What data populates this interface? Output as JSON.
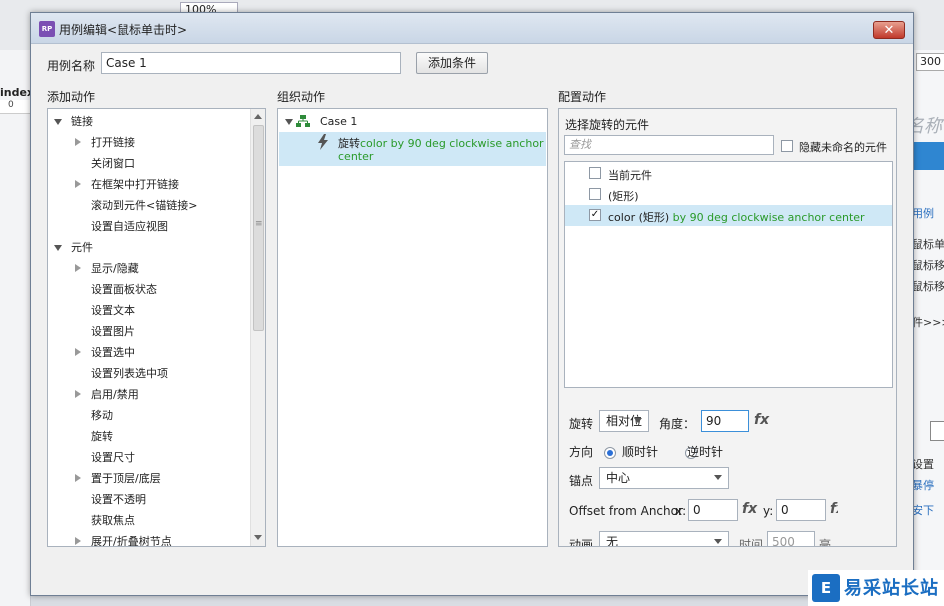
{
  "background": {
    "zoom_value": "100%",
    "index_label": "index",
    "ruler_zero": "0",
    "right_input_value": "300",
    "right_title": "名称",
    "right_link_case": "用例",
    "right_events": [
      "鼠标单击",
      "鼠标移入",
      "鼠标移出"
    ],
    "right_more": "件>>>",
    "right_settings": "设置",
    "right_link_stop": "暴停",
    "right_link_down": "安下"
  },
  "dialog": {
    "app_icon": "RP",
    "title": "用例编辑<鼠标单击时>",
    "close_symbol": "✕",
    "case_name_label": "用例名称",
    "case_name_value": "Case 1",
    "add_condition_label": "添加条件"
  },
  "add_actions": {
    "header": "添加动作",
    "items": [
      {
        "label": "链接",
        "level": 0,
        "arrow": "down"
      },
      {
        "label": "打开链接",
        "level": 1,
        "arrow": "right"
      },
      {
        "label": "关闭窗口",
        "level": 1,
        "arrow": "none"
      },
      {
        "label": "在框架中打开链接",
        "level": 1,
        "arrow": "right"
      },
      {
        "label": "滚动到元件<锚链接>",
        "level": 1,
        "arrow": "none"
      },
      {
        "label": "设置自适应视图",
        "level": 1,
        "arrow": "none"
      },
      {
        "label": "元件",
        "level": 0,
        "arrow": "down"
      },
      {
        "label": "显示/隐藏",
        "level": 1,
        "arrow": "right"
      },
      {
        "label": "设置面板状态",
        "level": 1,
        "arrow": "none"
      },
      {
        "label": "设置文本",
        "level": 1,
        "arrow": "none"
      },
      {
        "label": "设置图片",
        "level": 1,
        "arrow": "none"
      },
      {
        "label": "设置选中",
        "level": 1,
        "arrow": "right"
      },
      {
        "label": "设置列表选中项",
        "level": 1,
        "arrow": "none"
      },
      {
        "label": "启用/禁用",
        "level": 1,
        "arrow": "right"
      },
      {
        "label": "移动",
        "level": 1,
        "arrow": "none"
      },
      {
        "label": "旋转",
        "level": 1,
        "arrow": "none"
      },
      {
        "label": "设置尺寸",
        "level": 1,
        "arrow": "none"
      },
      {
        "label": "置于顶层/底层",
        "level": 1,
        "arrow": "right"
      },
      {
        "label": "设置不透明",
        "level": 1,
        "arrow": "none"
      },
      {
        "label": "获取焦点",
        "level": 1,
        "arrow": "none"
      },
      {
        "label": "展开/折叠树节点",
        "level": 1,
        "arrow": "right"
      }
    ]
  },
  "organize": {
    "header": "组织动作",
    "case_label": "Case 1",
    "action_name": "旋转",
    "action_detail_line1": "color by 90 deg clockwise anchor",
    "action_detail_line2": "center"
  },
  "configure": {
    "header": "配置动作",
    "select_label": "选择旋转的元件",
    "search_placeholder": "查找",
    "hide_unnamed_label": "隐藏未命名的元件",
    "widgets": [
      {
        "label": "当前元件",
        "detail": "",
        "checked": false
      },
      {
        "label": "(矩形)",
        "detail": "",
        "checked": false
      },
      {
        "label": "color (矩形)",
        "detail": "by 90 deg clockwise anchor center",
        "checked": true
      }
    ],
    "rotate_label": "旋转",
    "rotate_mode": "相对位",
    "angle_label": "角度：",
    "angle_value": "90",
    "fx_label": "fx",
    "direction_label": "方向",
    "clockwise_label": "顺时针",
    "counterclockwise_label": "逆时针",
    "anchor_label": "锚点",
    "anchor_value": "中心",
    "offset_label": "Offset from Anchor",
    "x_label": "x:",
    "x_value": "0",
    "y_label": "y:",
    "y_value": "0",
    "animate_label": "动画",
    "animate_value": "无",
    "time_label": "时间",
    "time_value": "500",
    "time_unit": "毫"
  },
  "watermark": {
    "icon_text": "E",
    "text": "易采站长站"
  },
  "colors": {
    "selected_bg": "#cfe8f6",
    "green_text": "#2a9a2a",
    "close_red": "#c0392b",
    "accent_blue": "#2b6fd6"
  }
}
